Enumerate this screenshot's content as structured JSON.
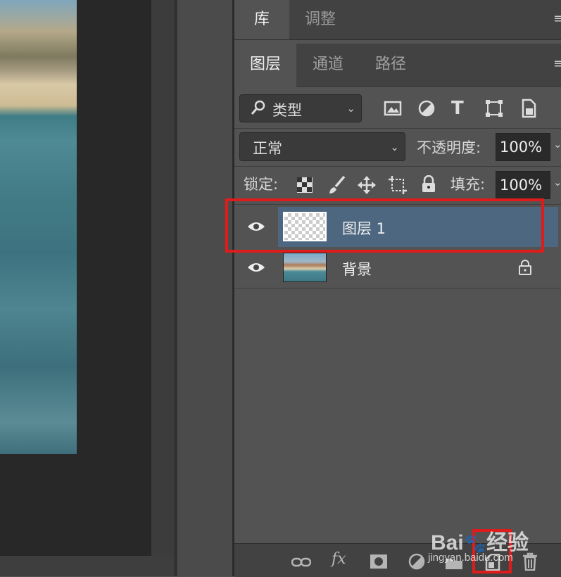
{
  "panel_tabs_top": {
    "library": "库",
    "adjustments": "调整"
  },
  "panel_tabs": {
    "layers": "图层",
    "channels": "通道",
    "paths": "路径"
  },
  "filter": {
    "kind_label": "类型"
  },
  "blend": {
    "mode": "正常",
    "opacity_label": "不透明度:",
    "opacity_value": "100%"
  },
  "lock": {
    "label": "锁定:",
    "fill_label": "填充:",
    "fill_value": "100%"
  },
  "layers": [
    {
      "name": "图层 1",
      "selected": true,
      "transparent": true,
      "locked": false
    },
    {
      "name": "背景",
      "selected": false,
      "transparent": false,
      "locked": true
    }
  ],
  "footer": {
    "fx_label": "fx"
  },
  "watermark": {
    "brand": "Bai",
    "brand2": "经验",
    "url": "jingyan.baidu.com"
  },
  "colors": {
    "selection": "#4e6780",
    "highlight": "#e01b1b",
    "panel": "#535353"
  }
}
